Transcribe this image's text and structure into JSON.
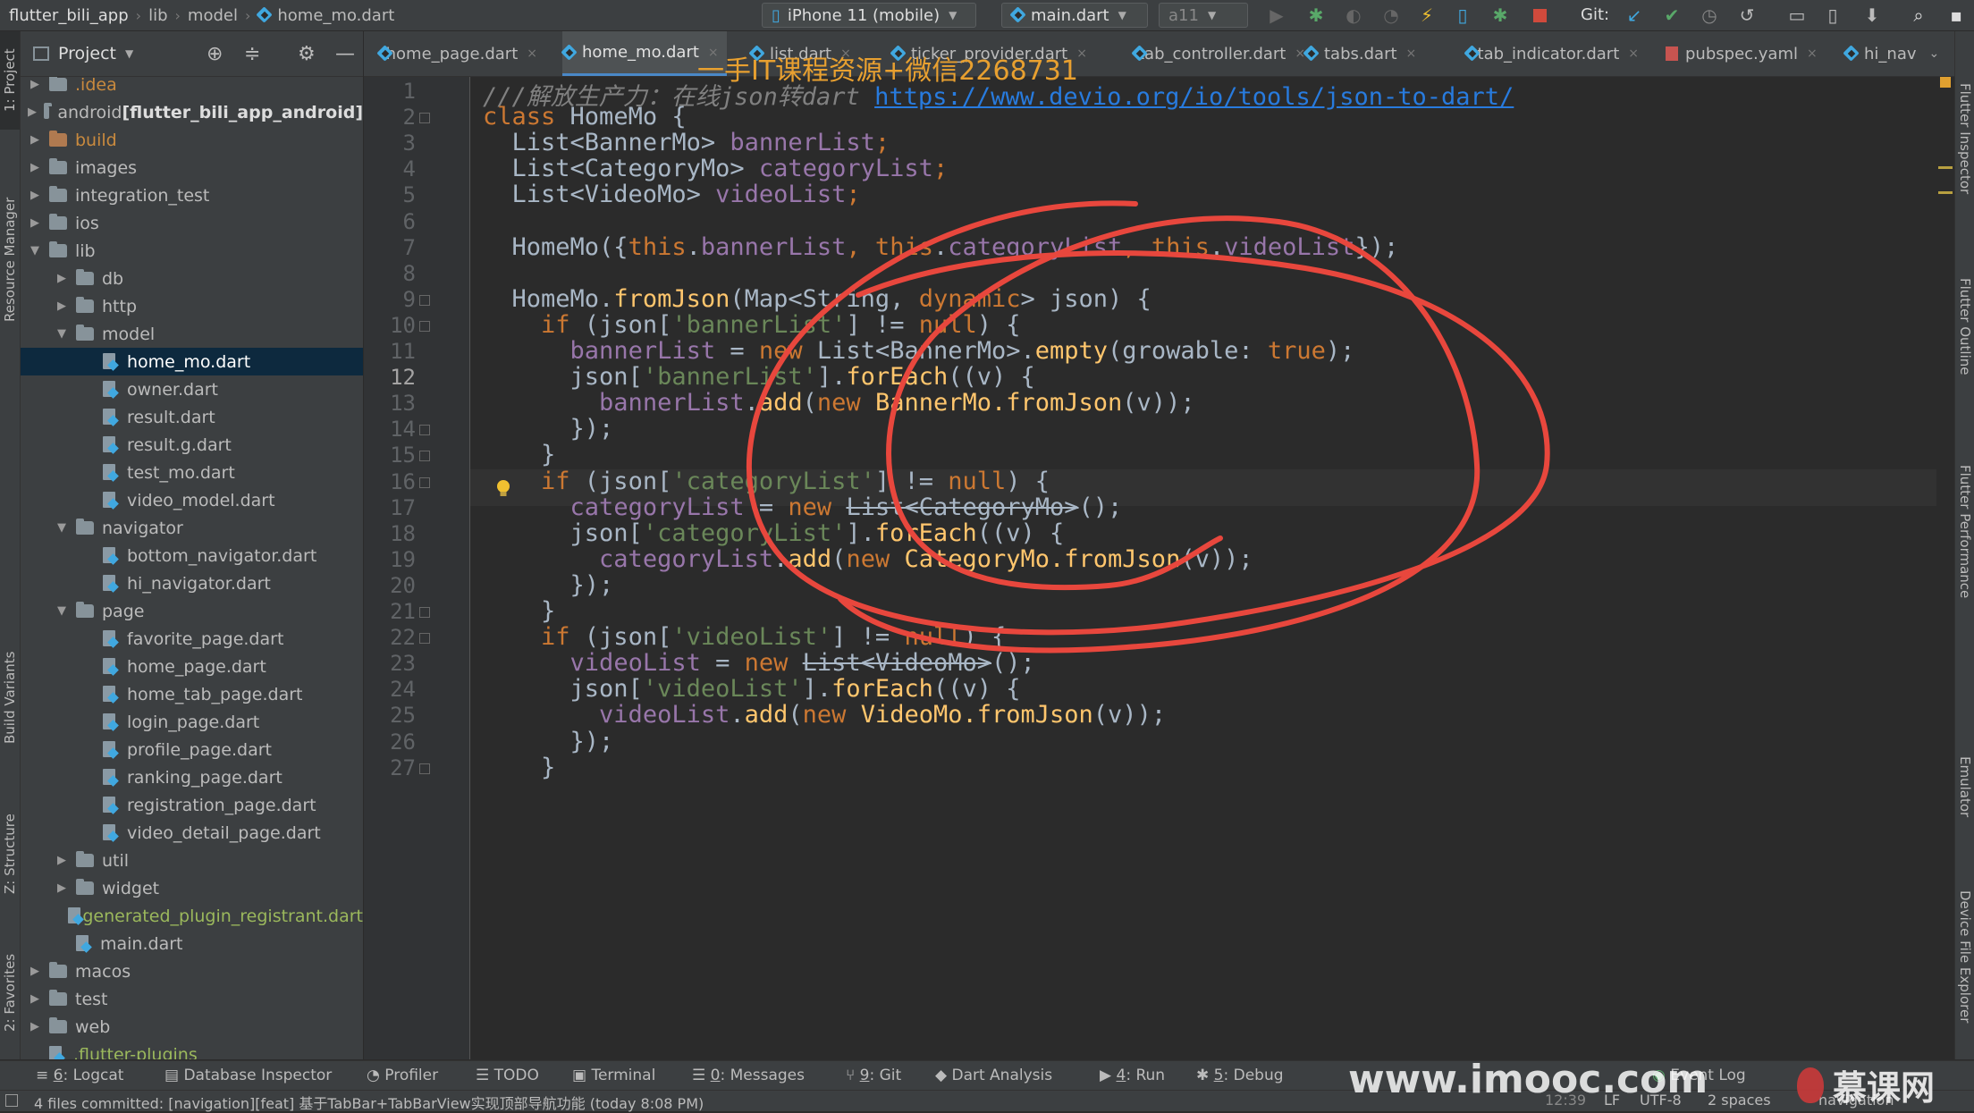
{
  "breadcrumb": [
    "flutter_bili_app",
    "lib",
    "model",
    "home_mo.dart"
  ],
  "run_config": {
    "device": "iPhone 11 (mobile)",
    "target": "main.dart",
    "config": "a11"
  },
  "git_label": "Git:",
  "project_panel": {
    "title": "Project",
    "tree": [
      {
        "label": ".idea",
        "depth": 0,
        "expanded": false,
        "kind": "folder",
        "style": "orange"
      },
      {
        "label": "android ",
        "bold": "[flutter_bili_app_android]",
        "depth": 0,
        "expanded": false,
        "kind": "folder"
      },
      {
        "label": "build",
        "depth": 0,
        "expanded": false,
        "kind": "folder-excl",
        "style": "orange"
      },
      {
        "label": "images",
        "depth": 0,
        "expanded": false,
        "kind": "folder"
      },
      {
        "label": "integration_test",
        "depth": 0,
        "expanded": false,
        "kind": "folder"
      },
      {
        "label": "ios",
        "depth": 0,
        "expanded": false,
        "kind": "folder"
      },
      {
        "label": "lib",
        "depth": 0,
        "expanded": true,
        "kind": "folder"
      },
      {
        "label": "db",
        "depth": 1,
        "expanded": false,
        "kind": "folder"
      },
      {
        "label": "http",
        "depth": 1,
        "expanded": false,
        "kind": "folder"
      },
      {
        "label": "model",
        "depth": 1,
        "expanded": true,
        "kind": "folder"
      },
      {
        "label": "home_mo.dart",
        "depth": 2,
        "kind": "dart",
        "selected": true
      },
      {
        "label": "owner.dart",
        "depth": 2,
        "kind": "dart"
      },
      {
        "label": "result.dart",
        "depth": 2,
        "kind": "dart"
      },
      {
        "label": "result.g.dart",
        "depth": 2,
        "kind": "dart"
      },
      {
        "label": "test_mo.dart",
        "depth": 2,
        "kind": "dart"
      },
      {
        "label": "video_model.dart",
        "depth": 2,
        "kind": "dart"
      },
      {
        "label": "navigator",
        "depth": 1,
        "expanded": true,
        "kind": "folder"
      },
      {
        "label": "bottom_navigator.dart",
        "depth": 2,
        "kind": "dart"
      },
      {
        "label": "hi_navigator.dart",
        "depth": 2,
        "kind": "dart"
      },
      {
        "label": "page",
        "depth": 1,
        "expanded": true,
        "kind": "folder"
      },
      {
        "label": "favorite_page.dart",
        "depth": 2,
        "kind": "dart"
      },
      {
        "label": "home_page.dart",
        "depth": 2,
        "kind": "dart"
      },
      {
        "label": "home_tab_page.dart",
        "depth": 2,
        "kind": "dart"
      },
      {
        "label": "login_page.dart",
        "depth": 2,
        "kind": "dart"
      },
      {
        "label": "profile_page.dart",
        "depth": 2,
        "kind": "dart"
      },
      {
        "label": "ranking_page.dart",
        "depth": 2,
        "kind": "dart"
      },
      {
        "label": "registration_page.dart",
        "depth": 2,
        "kind": "dart"
      },
      {
        "label": "video_detail_page.dart",
        "depth": 2,
        "kind": "dart"
      },
      {
        "label": "util",
        "depth": 1,
        "expanded": false,
        "kind": "folder"
      },
      {
        "label": "widget",
        "depth": 1,
        "expanded": false,
        "kind": "folder"
      },
      {
        "label": "generated_plugin_registrant.dart",
        "depth": 1,
        "kind": "dart",
        "style": "green"
      },
      {
        "label": "main.dart",
        "depth": 1,
        "kind": "dart"
      },
      {
        "label": "macos",
        "depth": 0,
        "expanded": false,
        "kind": "folder"
      },
      {
        "label": "test",
        "depth": 0,
        "expanded": false,
        "kind": "folder"
      },
      {
        "label": "web",
        "depth": 0,
        "expanded": false,
        "kind": "folder"
      },
      {
        "label": ".flutter-plugins",
        "depth": 0,
        "kind": "file",
        "style": "green"
      }
    ]
  },
  "tabs": [
    {
      "label": "home_page.dart",
      "active": false
    },
    {
      "label": "home_mo.dart",
      "active": true
    },
    {
      "label": "list.dart",
      "active": false
    },
    {
      "label": "ticker_provider.dart",
      "active": false
    },
    {
      "label": "tab_controller.dart",
      "active": false
    },
    {
      "label": "tabs.dart",
      "active": false
    },
    {
      "label": "tab_indicator.dart",
      "active": false
    },
    {
      "label": "pubspec.yaml",
      "active": false
    },
    {
      "label": "hi_nav",
      "active": false
    }
  ],
  "editor": {
    "current_line": 12,
    "lines": [
      {
        "n": 1,
        "tokens": [
          [
            "cmt",
            "///解放生产力：在线json转dart "
          ],
          [
            "link",
            "https://www.devio.org/io/tools/json-to-dart/"
          ]
        ]
      },
      {
        "n": 2,
        "tokens": [
          [
            "kw",
            "class "
          ],
          [
            "p",
            "HomeMo {"
          ]
        ]
      },
      {
        "n": 3,
        "tokens": [
          [
            "p",
            "  List<BannerMo> "
          ],
          [
            "fld",
            "bannerList"
          ],
          [
            "kw",
            ";"
          ]
        ]
      },
      {
        "n": 4,
        "tokens": [
          [
            "p",
            "  List<CategoryMo> "
          ],
          [
            "fld",
            "categoryList"
          ],
          [
            "kw",
            ";"
          ]
        ]
      },
      {
        "n": 5,
        "tokens": [
          [
            "p",
            "  List<VideoMo> "
          ],
          [
            "fld",
            "videoList"
          ],
          [
            "kw",
            ";"
          ]
        ]
      },
      {
        "n": 6,
        "tokens": []
      },
      {
        "n": 7,
        "tokens": [
          [
            "p",
            "  HomeMo({"
          ],
          [
            "kw",
            "this"
          ],
          [
            "p",
            "."
          ],
          [
            "fld",
            "bannerList"
          ],
          [
            "kw",
            ", this"
          ],
          [
            "p",
            "."
          ],
          [
            "fld",
            "categoryList"
          ],
          [
            "kw",
            ", this"
          ],
          [
            "p",
            "."
          ],
          [
            "fld",
            "videoList"
          ],
          [
            "p",
            "});"
          ]
        ]
      },
      {
        "n": 8,
        "tokens": []
      },
      {
        "n": 9,
        "tokens": [
          [
            "p",
            "  HomeMo."
          ],
          [
            "fn",
            "fromJson"
          ],
          [
            "p",
            "(Map<String, "
          ],
          [
            "kw",
            "dynamic"
          ],
          [
            "p",
            "> json) {"
          ]
        ]
      },
      {
        "n": 10,
        "tokens": [
          [
            "kw",
            "    if "
          ],
          [
            "p",
            "(json["
          ],
          [
            "str",
            "'bannerList'"
          ],
          [
            "p",
            "] != "
          ],
          [
            "kw",
            "null"
          ],
          [
            "p",
            ") {"
          ]
        ]
      },
      {
        "n": 11,
        "tokens": [
          [
            "p",
            "      "
          ],
          [
            "fld",
            "bannerList"
          ],
          [
            "p",
            " = "
          ],
          [
            "kw",
            "new "
          ],
          [
            "p",
            "List<BannerMo>."
          ],
          [
            "fn",
            "empty"
          ],
          [
            "p",
            "(growable: "
          ],
          [
            "kw",
            "true"
          ],
          [
            "p",
            ");"
          ]
        ]
      },
      {
        "n": 12,
        "tokens": [
          [
            "p",
            "      json["
          ],
          [
            "str",
            "'bannerList'"
          ],
          [
            "p",
            "]."
          ],
          [
            "fn",
            "forEach"
          ],
          [
            "p",
            "((v) {"
          ]
        ]
      },
      {
        "n": 13,
        "tokens": [
          [
            "p",
            "        "
          ],
          [
            "fld",
            "bannerList"
          ],
          [
            "p",
            "."
          ],
          [
            "fn",
            "add"
          ],
          [
            "p",
            "("
          ],
          [
            "kw",
            "new "
          ],
          [
            "fn",
            "BannerMo.fromJson"
          ],
          [
            "p",
            "(v));"
          ]
        ]
      },
      {
        "n": 14,
        "tokens": [
          [
            "p",
            "      });"
          ]
        ]
      },
      {
        "n": 15,
        "tokens": [
          [
            "p",
            "    }"
          ]
        ]
      },
      {
        "n": 16,
        "tokens": [
          [
            "kw",
            "    if "
          ],
          [
            "p",
            "(json["
          ],
          [
            "str",
            "'categoryList'"
          ],
          [
            "p",
            "] != "
          ],
          [
            "kw",
            "null"
          ],
          [
            "p",
            ") {"
          ]
        ]
      },
      {
        "n": 17,
        "tokens": [
          [
            "p",
            "      "
          ],
          [
            "fld",
            "categoryList"
          ],
          [
            "p",
            " = "
          ],
          [
            "kw",
            "new "
          ],
          [
            "dep",
            "List<CategoryMo>"
          ],
          [
            "p",
            "();"
          ]
        ]
      },
      {
        "n": 18,
        "tokens": [
          [
            "p",
            "      json["
          ],
          [
            "str",
            "'categoryList'"
          ],
          [
            "p",
            "]."
          ],
          [
            "fn",
            "forEach"
          ],
          [
            "p",
            "((v) {"
          ]
        ]
      },
      {
        "n": 19,
        "tokens": [
          [
            "p",
            "        "
          ],
          [
            "fld",
            "categoryList"
          ],
          [
            "p",
            "."
          ],
          [
            "fn",
            "add"
          ],
          [
            "p",
            "("
          ],
          [
            "kw",
            "new "
          ],
          [
            "fn",
            "CategoryMo.fromJson"
          ],
          [
            "p",
            "(v));"
          ]
        ]
      },
      {
        "n": 20,
        "tokens": [
          [
            "p",
            "      });"
          ]
        ]
      },
      {
        "n": 21,
        "tokens": [
          [
            "p",
            "    }"
          ]
        ]
      },
      {
        "n": 22,
        "tokens": [
          [
            "kw",
            "    if "
          ],
          [
            "p",
            "(json["
          ],
          [
            "str",
            "'videoList'"
          ],
          [
            "p",
            "] != "
          ],
          [
            "kw",
            "null"
          ],
          [
            "p",
            ") {"
          ]
        ]
      },
      {
        "n": 23,
        "tokens": [
          [
            "p",
            "      "
          ],
          [
            "fld",
            "videoList"
          ],
          [
            "p",
            " = "
          ],
          [
            "kw",
            "new "
          ],
          [
            "dep",
            "List<VideoMo>"
          ],
          [
            "p",
            "();"
          ]
        ]
      },
      {
        "n": 24,
        "tokens": [
          [
            "p",
            "      json["
          ],
          [
            "str",
            "'videoList'"
          ],
          [
            "p",
            "]."
          ],
          [
            "fn",
            "forEach"
          ],
          [
            "p",
            "((v) {"
          ]
        ]
      },
      {
        "n": 25,
        "tokens": [
          [
            "p",
            "        "
          ],
          [
            "fld",
            "videoList"
          ],
          [
            "p",
            "."
          ],
          [
            "fn",
            "add"
          ],
          [
            "p",
            "("
          ],
          [
            "kw",
            "new "
          ],
          [
            "fn",
            "VideoMo.fromJson"
          ],
          [
            "p",
            "(v));"
          ]
        ]
      },
      {
        "n": 26,
        "tokens": [
          [
            "p",
            "      });"
          ]
        ]
      },
      {
        "n": 27,
        "tokens": [
          [
            "p",
            "    }"
          ]
        ]
      }
    ]
  },
  "bottom_tools": [
    {
      "num": "6",
      "label": ": Logcat"
    },
    {
      "num": "",
      "label": "Database Inspector"
    },
    {
      "num": "",
      "label": "Profiler"
    },
    {
      "num": "",
      "label": "TODO"
    },
    {
      "num": "",
      "label": "Terminal"
    },
    {
      "num": "0",
      "label": ": Messages"
    },
    {
      "num": "9",
      "label": ": Git"
    },
    {
      "num": "",
      "label": "Dart Analysis"
    },
    {
      "num": "4",
      "label": ": Run"
    },
    {
      "num": "5",
      "label": ": Debug"
    },
    {
      "num": "",
      "label": "Event Log"
    }
  ],
  "status_bar": {
    "message": "4 files committed: [navigation][feat] 基于TabBar+TabBarView实现顶部导航功能 (today 8:08 PM)",
    "position": "12:39",
    "line_sep": "LF",
    "encoding": "UTF-8",
    "indent": "2 spaces",
    "branch": "navigation"
  },
  "left_strip": [
    "1: Project",
    "Resource Manager",
    "Build Variants",
    "Z: Structure",
    "2: Favorites"
  ],
  "right_strip": [
    "Flutter Inspector",
    "Flutter Outline",
    "Flutter Performance",
    "Emulator",
    "Device File Explorer"
  ],
  "watermarks": {
    "top": "一手IT课程资源+微信2268731",
    "bottom": "www.imooc.com",
    "logo": "慕课网"
  },
  "colors": {
    "annotation": "#e8473d",
    "selection": "#0d293e",
    "accent": "#4a88c7"
  }
}
